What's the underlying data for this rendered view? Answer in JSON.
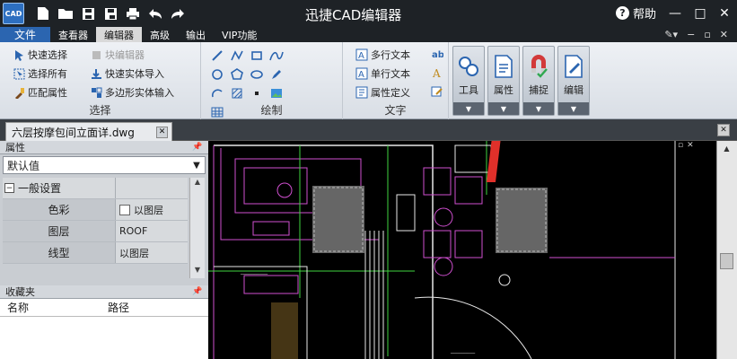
{
  "app": {
    "logo_text": "CAD",
    "title": "迅捷CAD编辑器",
    "help_label": "帮助",
    "window_controls": [
      "—",
      "□",
      "✕"
    ]
  },
  "menu": {
    "tabs": [
      {
        "label": "文件",
        "active": false,
        "file": true
      },
      {
        "label": "查看器",
        "active": false
      },
      {
        "label": "编辑器",
        "active": true
      },
      {
        "label": "高级",
        "active": false
      },
      {
        "label": "输出",
        "active": false
      },
      {
        "label": "VIP功能",
        "active": false
      }
    ]
  },
  "ribbon": {
    "select_group": {
      "label": "选择",
      "items": [
        {
          "label": "快速选择",
          "icon": "quick-select-icon",
          "enabled": true
        },
        {
          "label": "选择所有",
          "icon": "select-all-icon",
          "enabled": true
        },
        {
          "label": "匹配属性",
          "icon": "match-properties-icon",
          "enabled": true
        }
      ],
      "items2": [
        {
          "label": "块编辑器",
          "icon": "block-editor-icon",
          "enabled": false
        },
        {
          "label": "快速实体导入",
          "icon": "quick-entity-import-icon",
          "enabled": true
        },
        {
          "label": "多边形实体输入",
          "icon": "polygon-entity-input-icon",
          "enabled": true
        }
      ]
    },
    "draw_group": {
      "label": "绘制"
    },
    "text_group": {
      "label": "文字",
      "items": [
        {
          "label": "多行文本",
          "icon": "multiline-text-icon"
        },
        {
          "label": "单行文本",
          "icon": "single-line-text-icon"
        },
        {
          "label": "属性定义",
          "icon": "attribute-definition-icon"
        }
      ]
    },
    "big_buttons": [
      {
        "label": "工具",
        "icon": "tools-icon"
      },
      {
        "label": "属性",
        "icon": "properties-icon"
      },
      {
        "label": "捕捉",
        "icon": "snap-icon"
      },
      {
        "label": "编辑",
        "icon": "edit-icon"
      }
    ]
  },
  "document": {
    "tab_title": "六层按摩包间立面详.dwg"
  },
  "properties_panel": {
    "title": "属性",
    "dropdown_value": "默认值",
    "group_label": "一般设置",
    "rows": [
      {
        "key": "色彩",
        "value": "以图层"
      },
      {
        "key": "图层",
        "value": "ROOF"
      },
      {
        "key": "线型",
        "value": "以图层"
      }
    ]
  },
  "favorites_panel": {
    "title": "收藏夹",
    "columns": [
      "名称",
      "路径"
    ]
  },
  "annotation": {
    "arrow_color": "#e0302a"
  },
  "colors": {
    "cad_background": "#000000",
    "titlebar": "#1e2226",
    "file_tab": "#2b65b0"
  }
}
